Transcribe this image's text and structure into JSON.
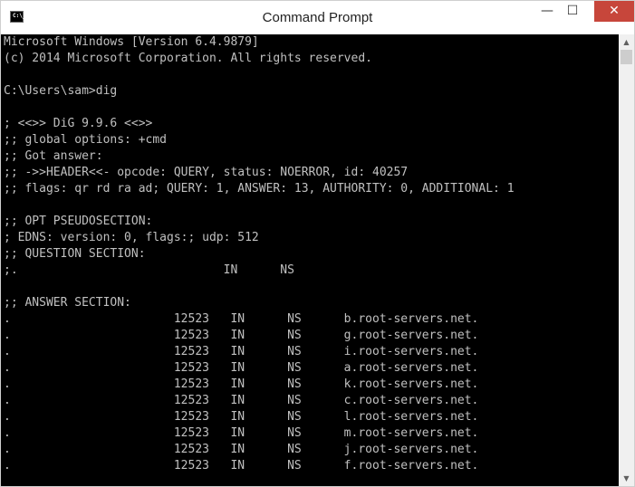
{
  "window": {
    "title": "Command Prompt",
    "icon_label": "C:\\_",
    "minimize_glyph": "—",
    "maximize_glyph": "☐",
    "close_glyph": "✕"
  },
  "console": {
    "text": "Microsoft Windows [Version 6.4.9879]\n(c) 2014 Microsoft Corporation. All rights reserved.\n\nC:\\Users\\sam>dig\n\n; <<>> DiG 9.9.6 <<>>\n;; global options: +cmd\n;; Got answer:\n;; ->>HEADER<<- opcode: QUERY, status: NOERROR, id: 40257\n;; flags: qr rd ra ad; QUERY: 1, ANSWER: 13, AUTHORITY: 0, ADDITIONAL: 1\n\n;; OPT PSEUDOSECTION:\n; EDNS: version: 0, flags:; udp: 512\n;; QUESTION SECTION:\n;.                             IN      NS\n\n;; ANSWER SECTION:\n.                       12523   IN      NS      b.root-servers.net.\n.                       12523   IN      NS      g.root-servers.net.\n.                       12523   IN      NS      i.root-servers.net.\n.                       12523   IN      NS      a.root-servers.net.\n.                       12523   IN      NS      k.root-servers.net.\n.                       12523   IN      NS      c.root-servers.net.\n.                       12523   IN      NS      l.root-servers.net.\n.                       12523   IN      NS      m.root-servers.net.\n.                       12523   IN      NS      j.root-servers.net.\n.                       12523   IN      NS      f.root-servers.net."
  },
  "scrollbar": {
    "up_glyph": "▲",
    "down_glyph": "▼"
  },
  "colors": {
    "console_bg": "#000000",
    "console_fg": "#c0c0c0",
    "close_button": "#c7463b"
  }
}
